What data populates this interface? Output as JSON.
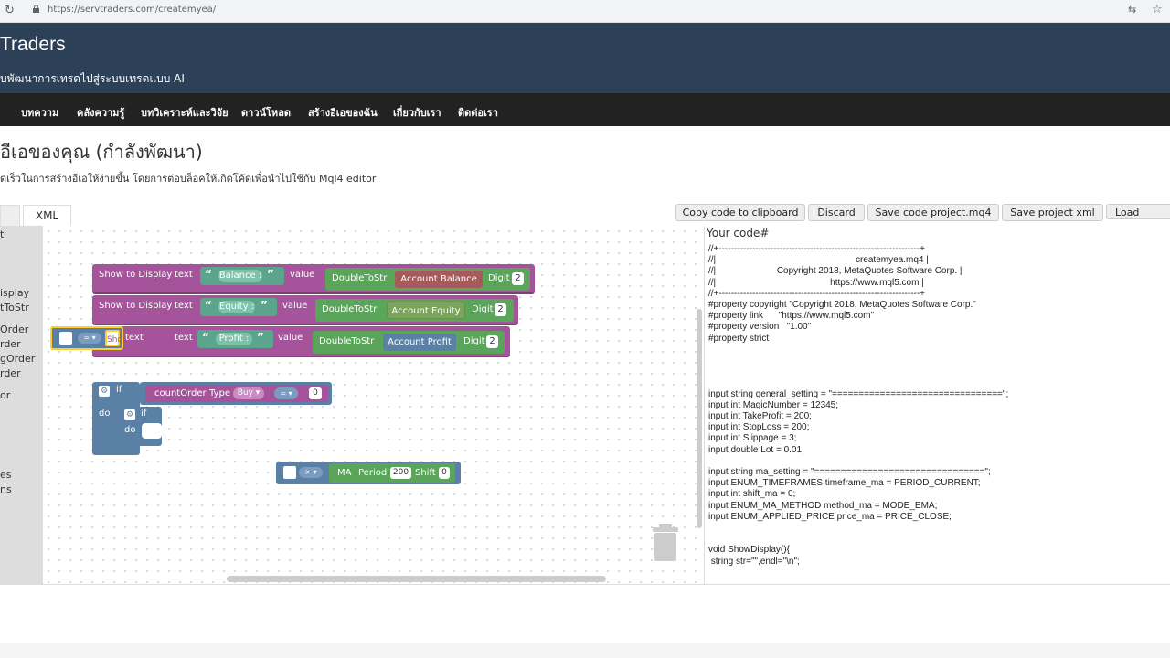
{
  "browser": {
    "url": "https://servtraders.com/createmyea/"
  },
  "header": {
    "title": "Traders",
    "tagline": "บพัฒนาการเทรดไปสู่ระบบเทรดแบบ AI"
  },
  "nav": {
    "items": [
      "บทความ",
      "คลังความรู้",
      "บทวิเคราะห์และวิจัย",
      "ดาวน์โหลด",
      "สร้างอีเอของฉัน",
      "เกี่ยวกับเรา",
      "ติดต่อเรา"
    ]
  },
  "page": {
    "title": "อีเอของคุณ (กำลังพัฒนา)",
    "description": "ดเร็วในการสร้างอีเอให้ง่ายขึ้น โดยการต่อบล็อคให้เกิดโค้ดเพื่อนำไปใช้กับ Mql4 editor"
  },
  "tabs": {
    "xml": "XML"
  },
  "buttons": {
    "copy": "Copy code to clipboard",
    "discard": "Discard",
    "save_code": "Save code project.mq4",
    "save_xml": "Save project xml",
    "load": "Load project"
  },
  "toolbox": {
    "items": [
      "t",
      "isplay",
      "tToStr",
      "Order",
      "rder",
      "gOrder",
      "rder",
      "or",
      "es",
      "ns"
    ]
  },
  "blocks": {
    "show_display": "Show to Display",
    "text": "text",
    "value": "value",
    "double_to_str": "DoubleToStr",
    "digit": "Digit",
    "digit_value": "2",
    "quote_open": "“",
    "quote_close": "”",
    "balance": "Balance :",
    "equity": "Equity :",
    "profit": "Profit :",
    "account_balance": "Account Balance",
    "account_equity": "Account Equity",
    "account_profit": "Account Profit",
    "if": "if",
    "do": "do",
    "count_order": "countOrder",
    "type": "Type",
    "type_value": "Buy ▾",
    "eq_op": "= ▾",
    "zero": "0",
    "gt_op": "> ▾",
    "ma": "MA",
    "period": "Period",
    "period_value": "200",
    "shift": "Shift",
    "shift_value": "0",
    "sho": "Sho",
    "gear": "⚙"
  },
  "code": {
    "title": "Your code#",
    "text": "//+------------------------------------------------------------------+\n//|                                                       createmyea.mq4 |\n//|                        Copyright 2018, MetaQuotes Software Corp. |\n//|                                             https://www.mql5.com |\n//+------------------------------------------------------------------+\n#property copyright \"Copyright 2018, MetaQuotes Software Corp.\"\n#property link      \"https://www.mql5.com\"\n#property version   \"1.00\"\n#property strict\n\n\n\n\ninput string general_setting = \"================================\";\ninput int MagicNumber = 12345;\ninput int TakeProfit = 200;\ninput int StopLoss = 200;\ninput int Slippage = 3;\ninput double Lot = 0.01;\n\ninput string ma_setting = \"================================\";\ninput ENUM_TIMEFRAMES timeframe_ma = PERIOD_CURRENT;\ninput int shift_ma = 0;\ninput ENUM_MA_METHOD method_ma = MODE_EMA;\ninput ENUM_APPLIED_PRICE price_ma = PRICE_CLOSE;\n\n\nvoid ShowDisplay(){\n string str=\"\",endl=\"\\n\";"
  },
  "colors": {
    "header_bg": "#2c4057",
    "nav_bg": "#222222",
    "text_block": "#a5549c",
    "string_block": "#5ba58c",
    "math_block": "#5ba55b",
    "account_balance": "#a55b5b",
    "account_equity": "#7ba55b",
    "account_profit": "#5b80a5",
    "logic_block": "#5b80a5"
  }
}
